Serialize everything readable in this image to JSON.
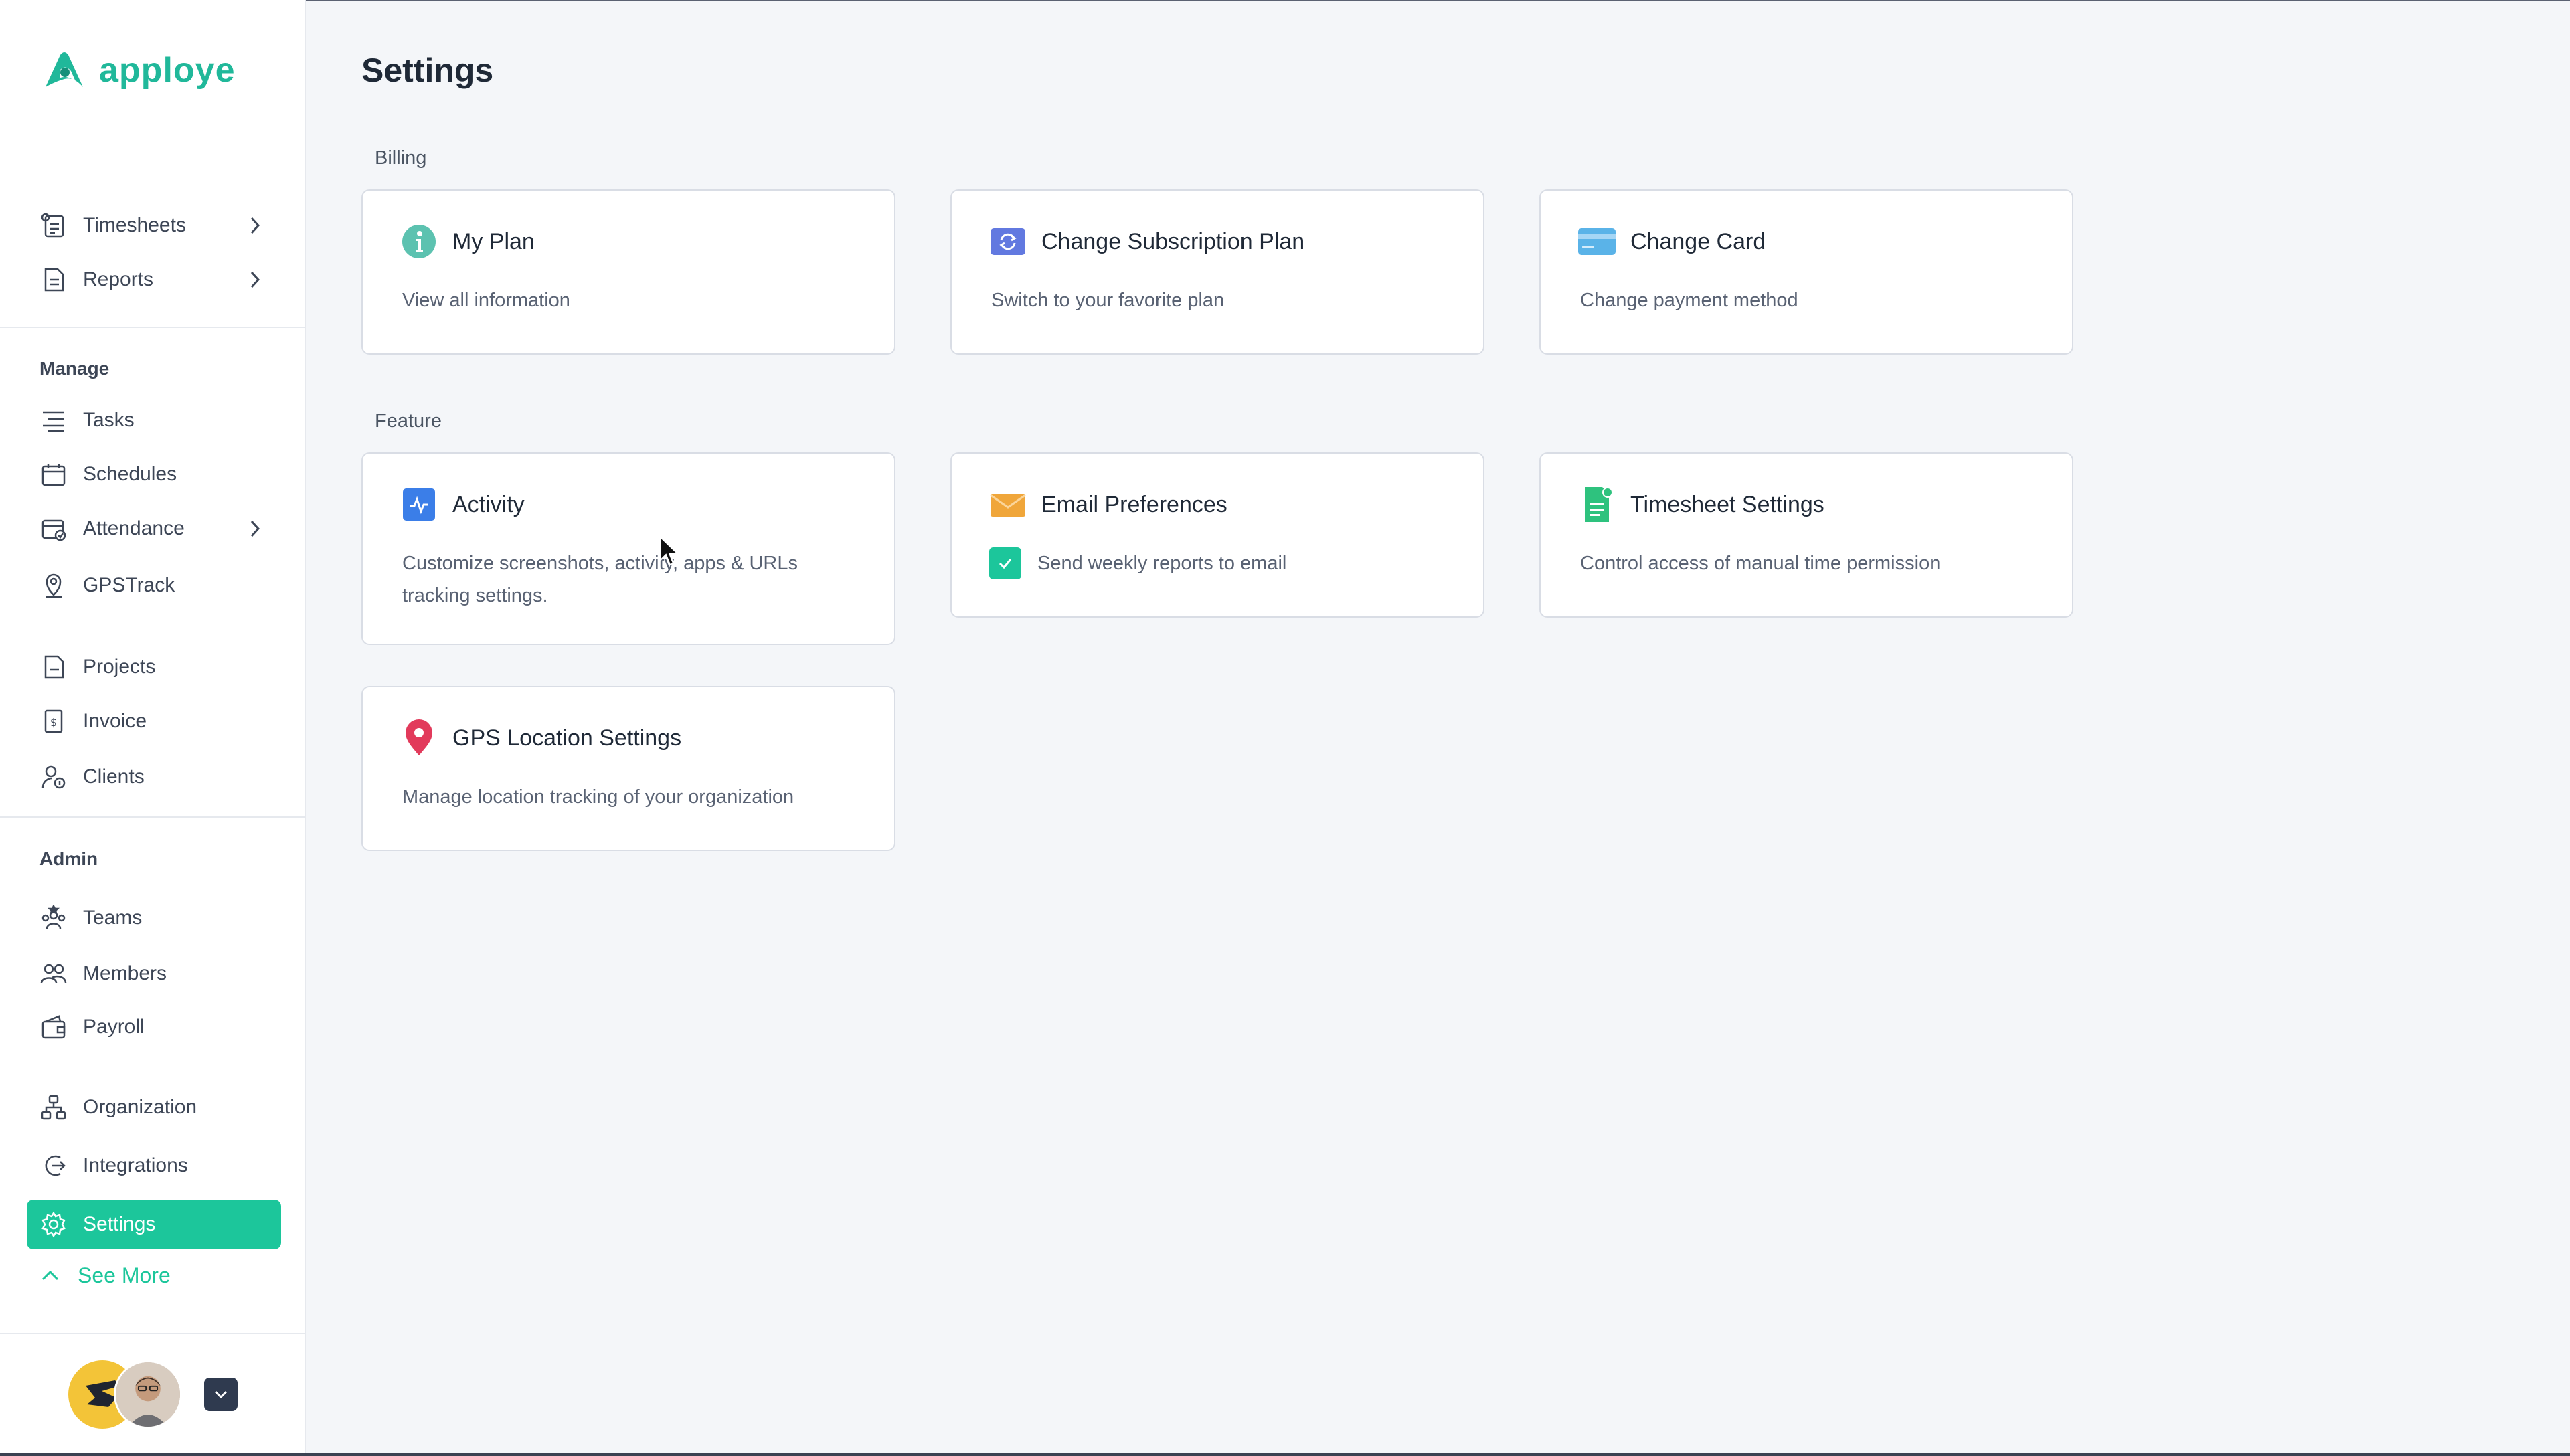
{
  "brand": {
    "name": "apploye",
    "accent": "#1cc69b",
    "logo_color": "#20b89a"
  },
  "sidebar": {
    "top_items": [
      {
        "label": "Timesheets",
        "icon": "timesheet-icon",
        "has_submenu": true
      },
      {
        "label": "Reports",
        "icon": "report-icon",
        "has_submenu": true
      }
    ],
    "manage_label": "Manage",
    "manage_items": [
      {
        "label": "Tasks",
        "icon": "tasks-icon"
      },
      {
        "label": "Schedules",
        "icon": "calendar-icon"
      },
      {
        "label": "Attendance",
        "icon": "attendance-icon",
        "has_submenu": true
      },
      {
        "label": "GPSTrack",
        "icon": "gps-pin-icon"
      },
      {
        "label": "Projects",
        "icon": "project-icon"
      },
      {
        "label": "Invoice",
        "icon": "invoice-icon"
      },
      {
        "label": "Clients",
        "icon": "clients-icon"
      }
    ],
    "admin_label": "Admin",
    "admin_items": [
      {
        "label": "Teams",
        "icon": "teams-icon"
      },
      {
        "label": "Members",
        "icon": "members-icon"
      },
      {
        "label": "Payroll",
        "icon": "wallet-icon"
      },
      {
        "label": "Organization",
        "icon": "organization-icon"
      },
      {
        "label": "Integrations",
        "icon": "integrations-icon"
      },
      {
        "label": "Settings",
        "icon": "gear-icon",
        "active": true
      }
    ],
    "see_more": "See More"
  },
  "main": {
    "title": "Settings",
    "billing_label": "Billing",
    "billing_cards": [
      {
        "title": "My Plan",
        "desc": "View all information",
        "icon": "info-icon",
        "color": "#5cc2b0"
      },
      {
        "title": "Change Subscription Plan",
        "desc": "Switch to your favorite plan",
        "icon": "refresh-icon",
        "color": "#6279e0"
      },
      {
        "title": "Change Card",
        "desc": "Change payment method",
        "icon": "credit-card-icon",
        "color": "#5ab3e8"
      }
    ],
    "feature_label": "Feature",
    "feature_cards": [
      {
        "title": "Activity",
        "desc": "Customize screenshots, activity, apps & URLs tracking settings.",
        "icon": "activity-icon",
        "color": "#3b7ee8"
      },
      {
        "title": "Email Preferences",
        "desc": "Send weekly reports to email",
        "icon": "mail-icon",
        "color": "#f0a63a",
        "checkbox_checked": true
      },
      {
        "title": "Timesheet Settings",
        "desc": "Control access of manual time permission",
        "icon": "timesheet-doc-icon",
        "color": "#2ec27e"
      }
    ],
    "gps_card": {
      "title": "GPS Location Settings",
      "desc": "Manage location tracking of your organization",
      "icon": "location-pin-icon",
      "color": "#e23a5b"
    }
  }
}
